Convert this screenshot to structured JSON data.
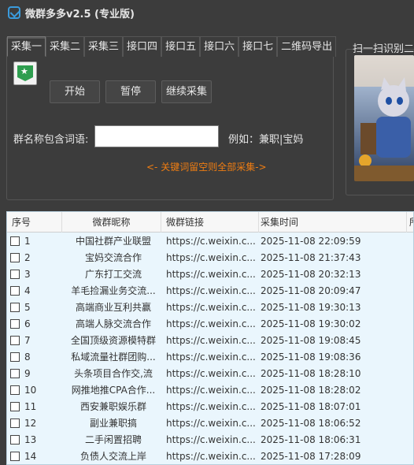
{
  "window": {
    "title": "微群多多v2.5 (专业版)"
  },
  "tabs": [
    "采集一",
    "采集二",
    "采集三",
    "接口四",
    "接口五",
    "接口六",
    "接口七",
    "二维码导出"
  ],
  "active_tab": 0,
  "buttons": {
    "start": "开始",
    "pause": "暂停",
    "continue": "继续采集"
  },
  "keyword": {
    "label": "群名称包含词语:",
    "value": "",
    "example": "例如：兼职|宝妈",
    "hint": "<- 关键词留空则全部采集->"
  },
  "qr": {
    "title": "扫一扫识别二维"
  },
  "colors": {
    "accent": "#ef7d12",
    "row_bg": "#eaf6fd",
    "bg": "#3c3c3c"
  },
  "table": {
    "headers": {
      "no": "序号",
      "name": "微群昵称",
      "link": "微群链接",
      "time": "采集时间",
      "extra": "所"
    },
    "rows": [
      {
        "no": "1",
        "name": "中国社群产业联盟",
        "link": "https://c.weixin.c...",
        "time": "2025-11-08 22:09:59"
      },
      {
        "no": "2",
        "name": "宝妈交流合作",
        "link": "https://c.weixin.c...",
        "time": "2025-11-08 21:37:43"
      },
      {
        "no": "3",
        "name": "广东打工交流",
        "link": "https://c.weixin.c...",
        "time": "2025-11-08 20:32:13"
      },
      {
        "no": "4",
        "name": "羊毛捡漏业务交流...",
        "link": "https://c.weixin.c...",
        "time": "2025-11-08 20:09:47"
      },
      {
        "no": "5",
        "name": "高端商业互利共赢",
        "link": "https://c.weixin.c...",
        "time": "2025-11-08 19:30:13"
      },
      {
        "no": "6",
        "name": "高端人脉交流合作",
        "link": "https://c.weixin.c...",
        "time": "2025-11-08 19:30:02"
      },
      {
        "no": "7",
        "name": "全国顶级资源模特群",
        "link": "https://c.weixin.c...",
        "time": "2025-11-08 19:08:45"
      },
      {
        "no": "8",
        "name": "私域流量社群团购...",
        "link": "https://c.weixin.c...",
        "time": "2025-11-08 19:08:36"
      },
      {
        "no": "9",
        "name": "头条项目合作交,流",
        "link": "https://c.weixin.c...",
        "time": "2025-11-08 18:28:10"
      },
      {
        "no": "10",
        "name": "网推地推CPA合作...",
        "link": "https://c.weixin.c...",
        "time": "2025-11-08 18:28:02"
      },
      {
        "no": "11",
        "name": "西安兼职娱乐群",
        "link": "https://c.weixin.c...",
        "time": "2025-11-08 18:07:01"
      },
      {
        "no": "12",
        "name": "副业兼职搞",
        "link": "https://c.weixin.c...",
        "time": "2025-11-08 18:06:52"
      },
      {
        "no": "13",
        "name": "二手闲置招聘",
        "link": "https://c.weixin.c...",
        "time": "2025-11-08 18:06:31"
      },
      {
        "no": "14",
        "name": "负债人交流上岸",
        "link": "https://c.weixin.c...",
        "time": "2025-11-08 17:28:09"
      }
    ]
  }
}
